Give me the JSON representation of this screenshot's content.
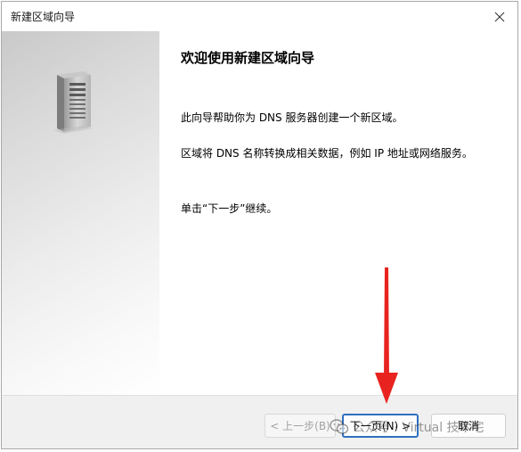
{
  "window": {
    "title": "新建区域向导",
    "close_icon": "close-icon"
  },
  "side_panel": {
    "icon": "server-icon"
  },
  "content": {
    "heading": "欢迎使用新建区域向导",
    "paragraph_1": "此向导帮助你为 DNS 服务器创建一个新区域。",
    "paragraph_2": "区域将 DNS 名称转换成相关数据，例如 IP 地址或网络服务。",
    "paragraph_3": "单击“下一步”继续。"
  },
  "footer": {
    "back_label": "< 上一步(B)",
    "next_label": "下一页(N) >",
    "cancel_label": "取消"
  },
  "annotation": {
    "arrow_color": "#e8231f",
    "arrow_icon": "red-arrow-down-icon"
  },
  "watermark": {
    "icon": "wechat-icon",
    "text": "公众号 · Virtual 技术宅"
  },
  "colors": {
    "accent": "#2f6fbf",
    "footer_bg": "#f0f0f0",
    "disabled_text": "#a3a3a3"
  }
}
